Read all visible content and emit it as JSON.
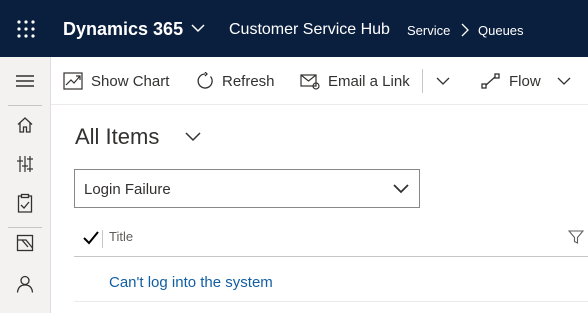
{
  "topbar": {
    "brand": "Dynamics 365",
    "app_name": "Customer Service Hub",
    "breadcrumb": [
      "Service",
      "Queues"
    ]
  },
  "icons": {
    "app_launcher": "waffle-icon",
    "brand_menu": "chevron-down-icon",
    "breadcrumb_separator": "chevron-right-icon",
    "rail": [
      "hamburger-icon",
      "home-icon",
      "sliders-icon",
      "clipboard-icon",
      "queue-icon",
      "person-icon"
    ]
  },
  "commands": {
    "show_chart": "Show Chart",
    "refresh": "Refresh",
    "email_link": "Email a Link",
    "flow": "Flow"
  },
  "view": {
    "title": "All Items",
    "filter_value": "Login Failure"
  },
  "grid": {
    "columns": [
      "Title"
    ],
    "rows": [
      {
        "title": "Can't log into the system"
      }
    ]
  },
  "colors": {
    "topbar_bg": "#0a1e3e",
    "rail_bg": "#f3f2f1",
    "link": "#115ea3",
    "text": "#323130"
  }
}
